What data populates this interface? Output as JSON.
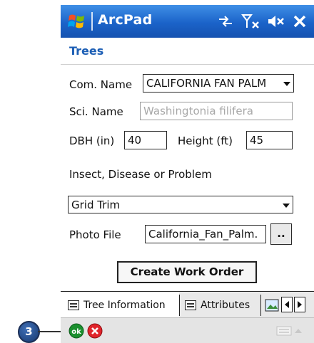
{
  "app": {
    "title": "ArcPad"
  },
  "form": {
    "heading": "Trees",
    "common_name": {
      "label": "Com. Name",
      "value": "CALIFORNIA FAN PALM"
    },
    "scientific_name": {
      "label": "Sci. Name",
      "value": "Washingtonia filifera"
    },
    "dbh": {
      "label": "DBH (in)",
      "value": "40"
    },
    "height": {
      "label": "Height (ft)",
      "value": "45"
    },
    "problem": {
      "label": "Insect, Disease or Problem",
      "value": "Grid Trim"
    },
    "photo_file": {
      "label": "Photo File",
      "value": "California_Fan_Palm.",
      "browse_label": ".."
    },
    "create_work_order_label": "Create Work Order"
  },
  "tabs": [
    {
      "label": "Tree Information",
      "active": true
    },
    {
      "label": "Attributes",
      "active": false
    }
  ],
  "callout": {
    "number": "3"
  },
  "colors": {
    "titlebar": "#1b63c9",
    "heading": "#1d5fb5",
    "ok": "#1a8f2e",
    "cancel": "#e0242b"
  }
}
